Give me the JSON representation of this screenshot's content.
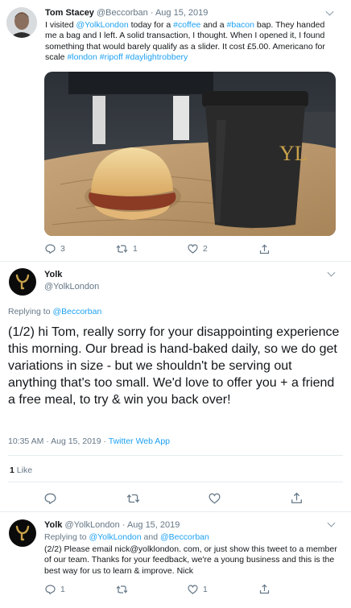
{
  "tweet1": {
    "name": "Tom Stacey",
    "handle": "@Beccorban",
    "date": "Aug 15, 2019",
    "text_segments": [
      {
        "t": "I visited ",
        "link": false
      },
      {
        "t": "@YolkLondon",
        "link": true
      },
      {
        "t": " today for a ",
        "link": false
      },
      {
        "t": "#coffee",
        "link": true
      },
      {
        "t": " and a ",
        "link": false
      },
      {
        "t": "#bacon",
        "link": true
      },
      {
        "t": " bap. They handed me a bag and I left. A solid transaction, I thought. When I opened it, I found something that would barely qualify as a slider. It cost £5.00. Americano for scale ",
        "link": false
      },
      {
        "t": "#london",
        "link": true
      },
      {
        "t": " ",
        "link": false
      },
      {
        "t": "#ripoff",
        "link": true
      },
      {
        "t": " ",
        "link": false
      },
      {
        "t": "#daylightrobbery",
        "link": true
      }
    ],
    "replies": "3",
    "retweets": "1",
    "likes": "2",
    "cup_logo": "YL"
  },
  "tweet2": {
    "name": "Yolk",
    "handle": "@YolkLondon",
    "replying_label": "Replying to",
    "replying_to": "@Beccorban",
    "text": "(1/2) hi Tom, really sorry for your disappointing experience this morning. Our bread is hand-baked daily, so we do get variations in size - but we shouldn't be serving out anything that's too small. We'd love to offer you + a friend a free meal, to try & win you back over!",
    "timestamp": "10:35 AM · Aug 15, 2019 · ",
    "source": "Twitter Web App",
    "like_count": "1",
    "like_label": "Like"
  },
  "tweet3": {
    "name": "Yolk",
    "handle": "@YolkLondon",
    "date": "Aug 15, 2019",
    "replying_label": "Replying to ",
    "replying_to_1": "@YolkLondon",
    "replying_and": " and ",
    "replying_to_2": "@Beccorban",
    "text": "(2/2) Please email nick@yolklondon. com, or just show this tweet to a member of our team. Thanks for your feedback, we're a young business and this is the best way for us to learn & improve. Nick",
    "replies": "1",
    "likes": "1"
  },
  "colors": {
    "accent": "#1da1f2",
    "muted": "#657786",
    "divider": "#e6ecf0",
    "logo_bg": "#0b0b0b",
    "logo_gold": "#c9a24b"
  },
  "icons": [
    "reply-icon",
    "retweet-icon",
    "like-icon",
    "share-icon",
    "chevron-down-icon",
    "yolk-logo"
  ]
}
